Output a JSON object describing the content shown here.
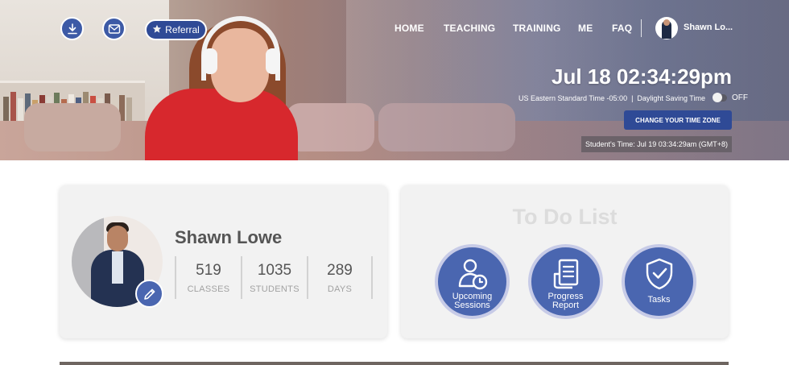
{
  "header": {
    "referral_label": "Referral",
    "nav": [
      {
        "label": "HOME"
      },
      {
        "label": "TEACHING"
      },
      {
        "label": "TRAINING"
      },
      {
        "label": "ME"
      },
      {
        "label": "FAQ"
      }
    ],
    "user_name": "Shawn Lo...",
    "clock": "Jul 18 02:34:29pm",
    "timezone": "US Eastern Standard Time -05:00",
    "separator": "|",
    "dst_label": "Daylight Saving Time",
    "dst_state": "OFF",
    "change_tz_label": "CHANGE YOUR TIME ZONE",
    "student_time": "Student's Time: Jul 19 03:34:29am (GMT+8)"
  },
  "profile": {
    "name": "Shawn Lowe",
    "stats": [
      {
        "value": "519",
        "label": "CLASSES"
      },
      {
        "value": "1035",
        "label": "STUDENTS"
      },
      {
        "value": "289",
        "label": "DAYS"
      }
    ]
  },
  "todo": {
    "title": "To Do List",
    "items": [
      {
        "label": "Upcoming\nSessions",
        "icon": "user-clock-icon"
      },
      {
        "label": "Progress\nReport",
        "icon": "report-icon"
      },
      {
        "label": "Tasks",
        "icon": "shield-check-icon"
      }
    ]
  },
  "colors": {
    "primary": "#2f4a96",
    "circle": "#4a66b0",
    "circle_ring": "#c7cbe7",
    "card_bg": "#f2f2f2",
    "todo_title": "#dcdcdc"
  }
}
